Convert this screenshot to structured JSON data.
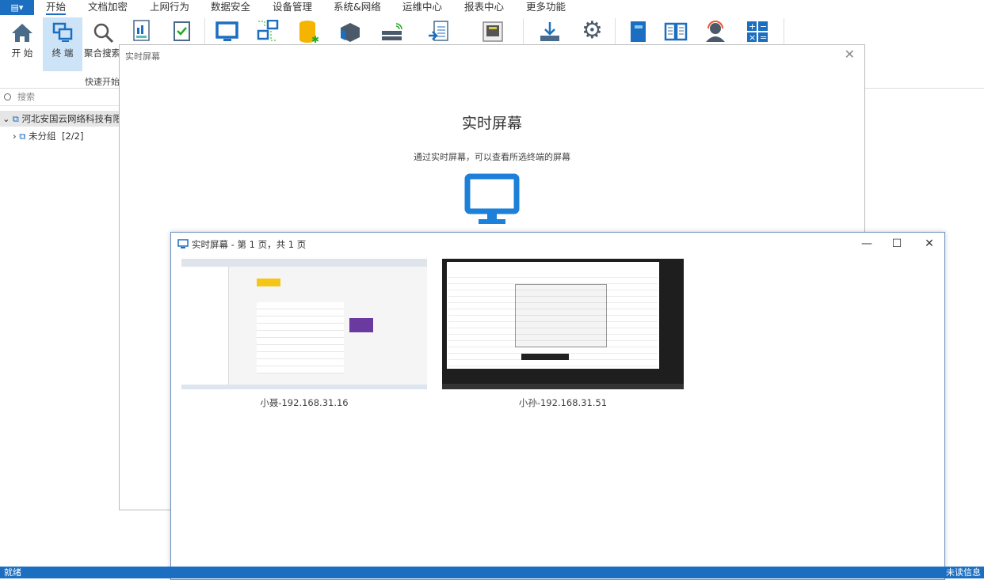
{
  "menubar": {
    "app_icon": "menu-icon",
    "tabs": [
      "开始",
      "文档加密",
      "上网行为",
      "数据安全",
      "设备管理",
      "系统&网络",
      "运维中心",
      "报表中心",
      "更多功能"
    ],
    "active": "开始"
  },
  "ribbon": {
    "buttons": [
      {
        "label": "开 始",
        "icon": "home-icon"
      },
      {
        "label": "终 端",
        "icon": "terminals-icon"
      },
      {
        "label": "聚合搜索",
        "icon": "search-icon"
      }
    ],
    "group_label": "快速开始"
  },
  "sidebar": {
    "search_placeholder": "搜索",
    "tree": [
      {
        "label": "河北安国云网络科技有限公",
        "expanded": true
      },
      {
        "label": "未分组  [2/2]",
        "expanded": false
      }
    ]
  },
  "dialog_intro": {
    "title": "实时屏幕",
    "heading": "实时屏幕",
    "description": "通过实时屏幕，可以查看所选终端的屏幕",
    "icon": "monitor-icon"
  },
  "dialog_screens": {
    "title": "实时屏幕 - 第 1 页，共 1 页",
    "screens": [
      {
        "label": "小聂-192.168.31.16"
      },
      {
        "label": "小孙-192.168.31.51"
      }
    ]
  },
  "statusbar": {
    "left": "就绪",
    "right": "未读信息"
  },
  "colors": {
    "accent": "#1c6fc0"
  }
}
